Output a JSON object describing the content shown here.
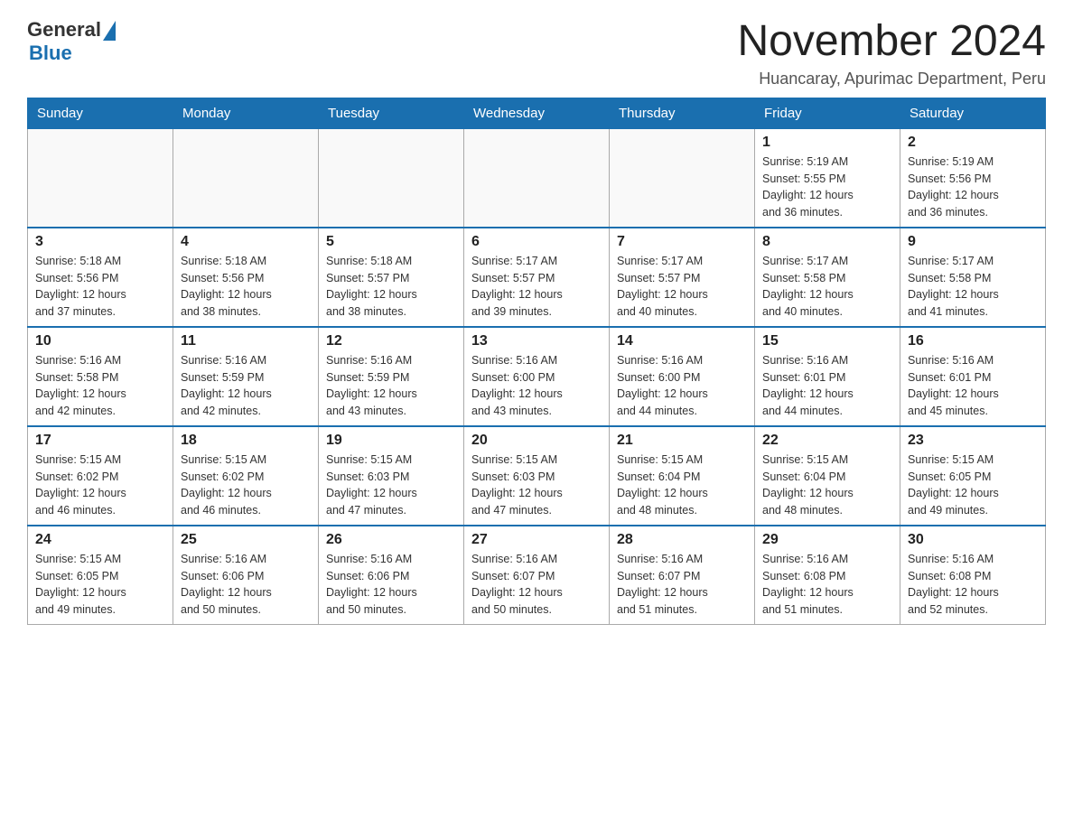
{
  "logo": {
    "text_general": "General",
    "text_blue": "Blue"
  },
  "title": "November 2024",
  "location": "Huancaray, Apurimac Department, Peru",
  "days_of_week": [
    "Sunday",
    "Monday",
    "Tuesday",
    "Wednesday",
    "Thursday",
    "Friday",
    "Saturday"
  ],
  "weeks": [
    [
      {
        "day": "",
        "info": ""
      },
      {
        "day": "",
        "info": ""
      },
      {
        "day": "",
        "info": ""
      },
      {
        "day": "",
        "info": ""
      },
      {
        "day": "",
        "info": ""
      },
      {
        "day": "1",
        "info": "Sunrise: 5:19 AM\nSunset: 5:55 PM\nDaylight: 12 hours\nand 36 minutes."
      },
      {
        "day": "2",
        "info": "Sunrise: 5:19 AM\nSunset: 5:56 PM\nDaylight: 12 hours\nand 36 minutes."
      }
    ],
    [
      {
        "day": "3",
        "info": "Sunrise: 5:18 AM\nSunset: 5:56 PM\nDaylight: 12 hours\nand 37 minutes."
      },
      {
        "day": "4",
        "info": "Sunrise: 5:18 AM\nSunset: 5:56 PM\nDaylight: 12 hours\nand 38 minutes."
      },
      {
        "day": "5",
        "info": "Sunrise: 5:18 AM\nSunset: 5:57 PM\nDaylight: 12 hours\nand 38 minutes."
      },
      {
        "day": "6",
        "info": "Sunrise: 5:17 AM\nSunset: 5:57 PM\nDaylight: 12 hours\nand 39 minutes."
      },
      {
        "day": "7",
        "info": "Sunrise: 5:17 AM\nSunset: 5:57 PM\nDaylight: 12 hours\nand 40 minutes."
      },
      {
        "day": "8",
        "info": "Sunrise: 5:17 AM\nSunset: 5:58 PM\nDaylight: 12 hours\nand 40 minutes."
      },
      {
        "day": "9",
        "info": "Sunrise: 5:17 AM\nSunset: 5:58 PM\nDaylight: 12 hours\nand 41 minutes."
      }
    ],
    [
      {
        "day": "10",
        "info": "Sunrise: 5:16 AM\nSunset: 5:58 PM\nDaylight: 12 hours\nand 42 minutes."
      },
      {
        "day": "11",
        "info": "Sunrise: 5:16 AM\nSunset: 5:59 PM\nDaylight: 12 hours\nand 42 minutes."
      },
      {
        "day": "12",
        "info": "Sunrise: 5:16 AM\nSunset: 5:59 PM\nDaylight: 12 hours\nand 43 minutes."
      },
      {
        "day": "13",
        "info": "Sunrise: 5:16 AM\nSunset: 6:00 PM\nDaylight: 12 hours\nand 43 minutes."
      },
      {
        "day": "14",
        "info": "Sunrise: 5:16 AM\nSunset: 6:00 PM\nDaylight: 12 hours\nand 44 minutes."
      },
      {
        "day": "15",
        "info": "Sunrise: 5:16 AM\nSunset: 6:01 PM\nDaylight: 12 hours\nand 44 minutes."
      },
      {
        "day": "16",
        "info": "Sunrise: 5:16 AM\nSunset: 6:01 PM\nDaylight: 12 hours\nand 45 minutes."
      }
    ],
    [
      {
        "day": "17",
        "info": "Sunrise: 5:15 AM\nSunset: 6:02 PM\nDaylight: 12 hours\nand 46 minutes."
      },
      {
        "day": "18",
        "info": "Sunrise: 5:15 AM\nSunset: 6:02 PM\nDaylight: 12 hours\nand 46 minutes."
      },
      {
        "day": "19",
        "info": "Sunrise: 5:15 AM\nSunset: 6:03 PM\nDaylight: 12 hours\nand 47 minutes."
      },
      {
        "day": "20",
        "info": "Sunrise: 5:15 AM\nSunset: 6:03 PM\nDaylight: 12 hours\nand 47 minutes."
      },
      {
        "day": "21",
        "info": "Sunrise: 5:15 AM\nSunset: 6:04 PM\nDaylight: 12 hours\nand 48 minutes."
      },
      {
        "day": "22",
        "info": "Sunrise: 5:15 AM\nSunset: 6:04 PM\nDaylight: 12 hours\nand 48 minutes."
      },
      {
        "day": "23",
        "info": "Sunrise: 5:15 AM\nSunset: 6:05 PM\nDaylight: 12 hours\nand 49 minutes."
      }
    ],
    [
      {
        "day": "24",
        "info": "Sunrise: 5:15 AM\nSunset: 6:05 PM\nDaylight: 12 hours\nand 49 minutes."
      },
      {
        "day": "25",
        "info": "Sunrise: 5:16 AM\nSunset: 6:06 PM\nDaylight: 12 hours\nand 50 minutes."
      },
      {
        "day": "26",
        "info": "Sunrise: 5:16 AM\nSunset: 6:06 PM\nDaylight: 12 hours\nand 50 minutes."
      },
      {
        "day": "27",
        "info": "Sunrise: 5:16 AM\nSunset: 6:07 PM\nDaylight: 12 hours\nand 50 minutes."
      },
      {
        "day": "28",
        "info": "Sunrise: 5:16 AM\nSunset: 6:07 PM\nDaylight: 12 hours\nand 51 minutes."
      },
      {
        "day": "29",
        "info": "Sunrise: 5:16 AM\nSunset: 6:08 PM\nDaylight: 12 hours\nand 51 minutes."
      },
      {
        "day": "30",
        "info": "Sunrise: 5:16 AM\nSunset: 6:08 PM\nDaylight: 12 hours\nand 52 minutes."
      }
    ]
  ]
}
